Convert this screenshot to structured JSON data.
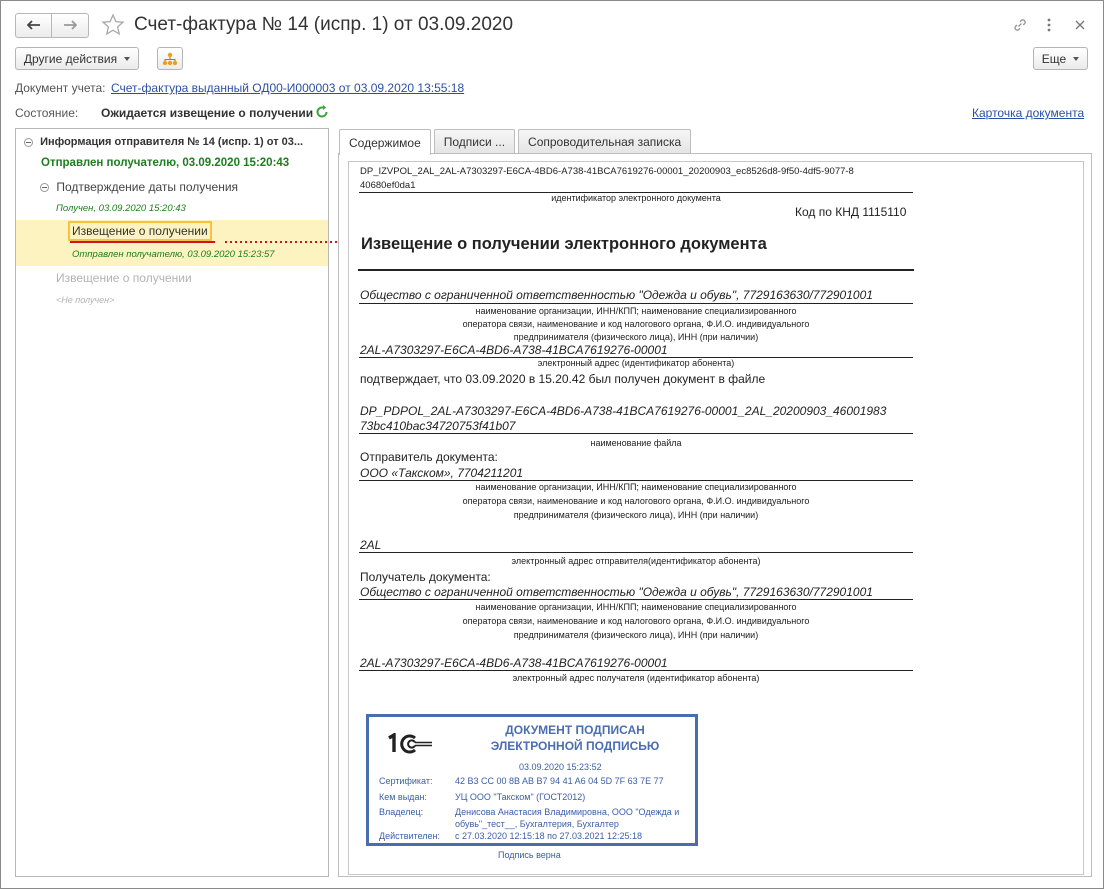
{
  "window": {
    "title": "Счет-фактура № 14 (испр. 1) от 03.09.2020"
  },
  "toolbar": {
    "other_actions": "Другие действия",
    "more": "Еще"
  },
  "account_doc": {
    "label": "Документ учета:",
    "value": "Счет-фактура выданный ОД00-И000003 от 03.09.2020 13:55:18"
  },
  "state": {
    "label": "Состояние:",
    "value": "Ожидается извещение о получении"
  },
  "doc_card_link": "Карточка документа",
  "tree": {
    "root": "Информация отправителя № 14 (испр. 1) от 03...",
    "root_status": "Отправлен получателю, 03.09.2020 15:20:43",
    "confirm": "Подтверждение даты получения",
    "confirm_status": "Получен, 03.09.2020 15:20:43",
    "notice1": "Извещение о получении",
    "notice1_status": "Отправлен получателю, 03.09.2020 15:23:57",
    "notice2": "Извещение о получении",
    "notice2_status": "<Не получен>"
  },
  "tabs": [
    "Содержимое",
    "Подписи ...",
    "Сопроводительная записка"
  ],
  "doc": {
    "file_id_1": "DP_IZVPOL_2AL_2AL-A7303297-E6CA-4BD6-A738-41BCA7619276-00001_20200903_ec8526d8-9f50-4df5-9077-8",
    "file_id_2": "40680ef0da1",
    "file_id_caption": "идентификатор электронного документа",
    "knd": "Код по КНД 1115110",
    "heading": "Извещение о получении электронного документа",
    "org": "Общество с ограниченной ответственностью \"Одежда и обувь\", 7729163630/772901001",
    "org_caption_1": "наименование организации, ИНН/КПП; наименование специализированного",
    "org_caption_2": "оператора связи, наименование и код налогового органа, Ф.И.О. индивидуального",
    "org_caption_3": "предпринимателя (физического лица), ИНН (при наличии)",
    "addr": "2AL-A7303297-E6CA-4BD6-A738-41BCA7619276-00001",
    "addr_caption": "электронный адрес (идентификатор абонента)",
    "confirm_text": "подтверждает, что 03.09.2020 в 15.20.42 был получен документ в файле",
    "file_1": "DP_PDPOL_2AL-A7303297-E6CA-4BD6-A738-41BCA7619276-00001_2AL_20200903_46001983",
    "file_2": "73bc410bac34720753f41b07",
    "file_caption": "наименование файла",
    "sender_label": "Отправитель документа:",
    "sender": "ООО «Такском», 7704211201",
    "sender_caption_1": "наименование организации, ИНН/КПП; наименование специализированного",
    "sender_caption_2": "оператора связи, наименование и код налогового органа, Ф.И.О. индивидуального",
    "sender_caption_3": "предпринимателя (физического лица), ИНН (при наличии)",
    "sender_addr": "2AL",
    "sender_addr_caption": "электронный адрес отправителя(идентификатор абонента)",
    "recipient_label": "Получатель документа:",
    "recipient": "Общество с ограниченной ответственностью \"Одежда и обувь\", 7729163630/772901001",
    "recipient_caption_1": "наименование организации, ИНН/КПП; наименование специализированного",
    "recipient_caption_2": "оператора связи, наименование и код налогового органа, Ф.И.О. индивидуального",
    "recipient_caption_3": "предпринимателя (физического лица), ИНН (при наличии)",
    "recipient_addr": "2AL-A7303297-E6CA-4BD6-A738-41BCA7619276-00001",
    "recipient_addr_caption": "электронный адрес получателя (идентификатор абонента)"
  },
  "stamp": {
    "title_1": "ДОКУМЕНТ ПОДПИСАН",
    "title_2": "ЭЛЕКТРОННОЙ ПОДПИСЬЮ",
    "date": "03.09.2020 15:23:52",
    "cert_label": "Сертификат:",
    "cert_value": "42 B3 CC 00 8B AB B7 94 41 A6 04 5D 7F 63 7E 77",
    "issuer_label": "Кем выдан:",
    "issuer_value": "УЦ ООО \"Такском\" (ГОСТ2012)",
    "owner_label": "Владелец:",
    "owner_value_1": "Денисова Анастасия Владимировна, ООО \"Одежда и",
    "owner_value_2": "обувь\"_тест__, Бухгалтерия, Бухгалтер",
    "valid_label": "Действителен:",
    "valid_value": "с 27.03.2020 12:15:18 по 27.03.2021 12:25:18",
    "verified": "Подпись верна"
  },
  "colors": {
    "green": "#1e7d1e",
    "link": "#2b4fa8",
    "highlight": "#fdf3c0",
    "selection": "#f5c33c",
    "arrow": "#d0121b",
    "stamp": "#4a6db0"
  }
}
